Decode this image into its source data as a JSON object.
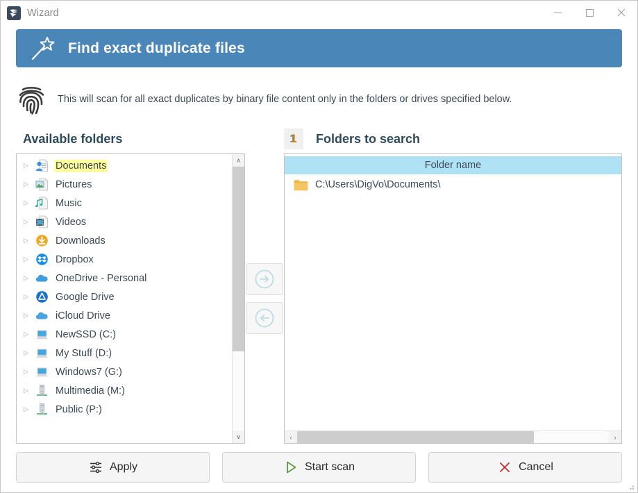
{
  "window": {
    "title": "Wizard",
    "app_icon": "wizard-swirl-icon",
    "controls": {
      "minimize": "minimize-icon",
      "maximize": "maximize-icon",
      "close": "close-icon"
    }
  },
  "banner": {
    "icon": "magic-wand-icon",
    "title": "Find exact duplicate files",
    "color": "#4b86b8"
  },
  "description": {
    "icon": "fingerprint-icon",
    "text": "This will scan for all exact duplicates by binary file content only in the folders or drives specified below."
  },
  "left_panel": {
    "heading": "Available folders",
    "items": [
      {
        "label": "Documents",
        "icon": "documents-folder-icon",
        "selected": true
      },
      {
        "label": "Pictures",
        "icon": "pictures-folder-icon",
        "selected": false
      },
      {
        "label": "Music",
        "icon": "music-folder-icon",
        "selected": false
      },
      {
        "label": "Videos",
        "icon": "videos-folder-icon",
        "selected": false
      },
      {
        "label": "Downloads",
        "icon": "downloads-icon",
        "selected": false
      },
      {
        "label": "Dropbox",
        "icon": "dropbox-icon",
        "selected": false
      },
      {
        "label": "OneDrive - Personal",
        "icon": "onedrive-cloud-icon",
        "selected": false
      },
      {
        "label": "Google Drive",
        "icon": "google-drive-icon",
        "selected": false
      },
      {
        "label": "iCloud Drive",
        "icon": "icloud-cloud-icon",
        "selected": false
      },
      {
        "label": "NewSSD (C:)",
        "icon": "drive-computer-icon",
        "selected": false
      },
      {
        "label": "My Stuff (D:)",
        "icon": "drive-computer-icon",
        "selected": false
      },
      {
        "label": "Windows7 (G:)",
        "icon": "drive-computer-icon",
        "selected": false
      },
      {
        "label": "Multimedia (M:)",
        "icon": "network-drive-icon",
        "selected": false
      },
      {
        "label": "Public (P:)",
        "icon": "network-drive-icon",
        "selected": false
      }
    ],
    "scroll_up": "∧",
    "scroll_down": "∨"
  },
  "transfer": {
    "add_label": "add-to-search-arrow",
    "remove_label": "remove-from-search-arrow"
  },
  "right_panel": {
    "count": "1",
    "heading": "Folders to search",
    "column_header": "Folder name",
    "rows": [
      {
        "path": "C:\\Users\\DigVo\\Documents\\",
        "icon": "folder-icon"
      }
    ],
    "scroll_left": "‹",
    "scroll_right": "›"
  },
  "footer": {
    "buttons": [
      {
        "label": "Apply",
        "icon": "sliders-icon"
      },
      {
        "label": "Start scan",
        "icon": "play-triangle-icon"
      },
      {
        "label": "Cancel",
        "icon": "x-mark-icon"
      }
    ]
  }
}
